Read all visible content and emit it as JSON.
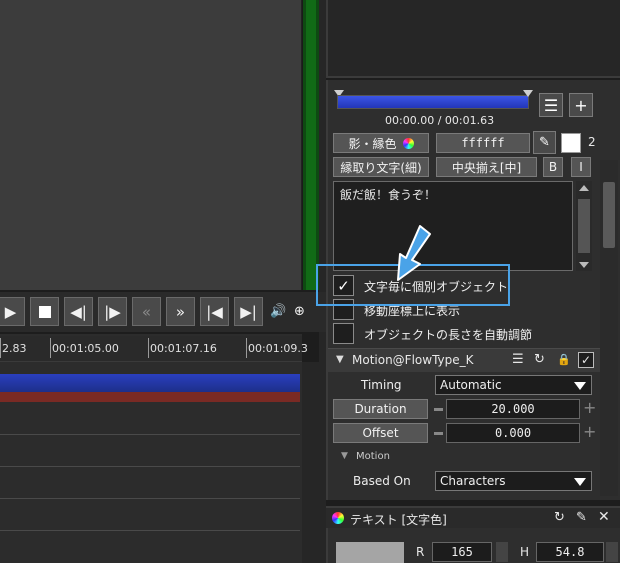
{
  "transport": {
    "icons": [
      "play-icon",
      "stop-icon",
      "step-back-icon",
      "step-forward-icon",
      "rewind-icon",
      "fast-forward-icon",
      "jump-start-icon",
      "jump-end-icon",
      "volume-icon",
      "zoom-icon"
    ]
  },
  "timeline": {
    "ticks": [
      "2.83",
      "00:01:05.00",
      "00:01:07.16",
      "00:01:09.3"
    ]
  },
  "properties": {
    "time_readout": "00:00.00 / 00:01.63",
    "shadow_color_label": "影・縁色",
    "color_hex": "ffffff",
    "font_size_partial": "2",
    "outline_style_label": "縁取り文字(細)",
    "align_label": "中央揃え[中]",
    "bold_label": "B",
    "italic_label": "I",
    "text_content": "飯だ飯！食うぞ！",
    "checkboxes": [
      {
        "label": "文字毎に個別オブジェクト",
        "checked": true
      },
      {
        "label": "移動座標上に表示",
        "checked": false
      },
      {
        "label": "オブジェクトの長さを自動調節",
        "checked": false
      }
    ]
  },
  "effect": {
    "title": "Motion@FlowType_K",
    "timing_label": "Timing",
    "timing_value": "Automatic",
    "duration_label": "Duration",
    "duration_value": "20.000",
    "offset_label": "Offset",
    "offset_value": "0.000",
    "motion_section": "Motion",
    "based_on_label": "Based On",
    "based_on_value": "Characters"
  },
  "text_panel": {
    "title": "テキスト [文字色]",
    "r_label": "R",
    "r_value": "165",
    "h_label": "H",
    "h_value": "54.8"
  }
}
